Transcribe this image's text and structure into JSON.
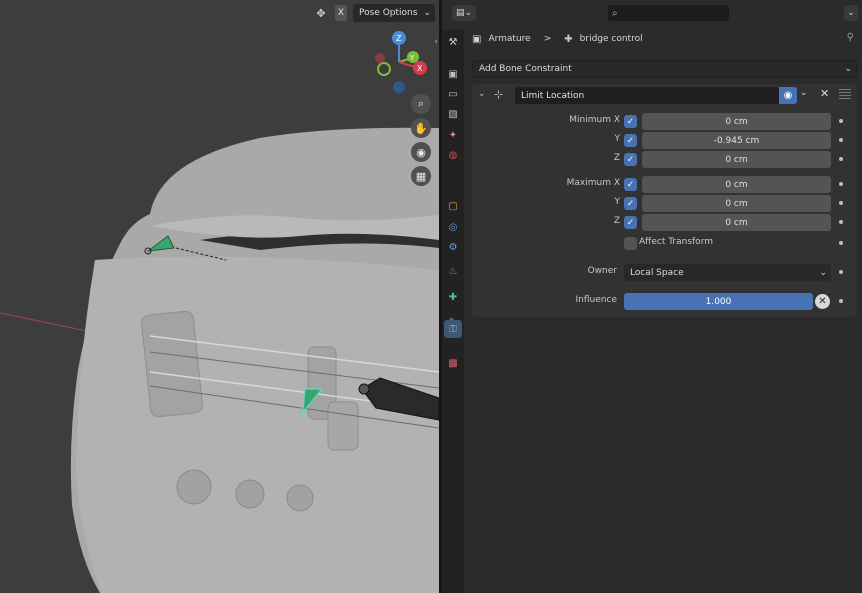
{
  "viewport": {
    "header": {
      "gizmo_toggle_icon": "gizmo-toggle-icon",
      "x_mirror_label": "X",
      "pose_options_label": "Pose Options",
      "dropdown_icon": "chevron-down-icon"
    },
    "gizmo": {
      "z_label": "Z",
      "y_label": "Y",
      "x_label": "X"
    },
    "tools": [
      "zoom-icon",
      "hand-pan-icon",
      "camera-icon",
      "grid-icon"
    ],
    "collapse_icon": "chevron-left-icon"
  },
  "properties": {
    "header": {
      "editor_type_icon": "properties-editor-icon",
      "search_icon": "search-icon",
      "options_icon": "chevron-down-icon"
    },
    "tabs": [
      "tool-icon",
      "render-icon",
      "output-icon",
      "view-layer-icon",
      "scene-icon",
      "world-icon",
      "object-icon",
      "modifier-icon",
      "particles-icon",
      "physics-icon",
      "object-data-icon",
      "bone-icon",
      "bone-constraint-icon",
      "texture-icon"
    ],
    "active_tab": "bone-constraint-icon",
    "breadcrumb": {
      "object": "Armature",
      "separator": ">",
      "bone": "bridge control"
    },
    "add_constraint_label": "Add Bone Constraint",
    "constraint": {
      "name": "Limit Location",
      "rows": {
        "min_x": {
          "label": "Minimum X",
          "checked": true,
          "value": "0 cm"
        },
        "min_y": {
          "label": "Y",
          "checked": true,
          "value": "-0.945 cm"
        },
        "min_z": {
          "label": "Z",
          "checked": true,
          "value": "0 cm"
        },
        "max_x": {
          "label": "Maximum X",
          "checked": true,
          "value": "0 cm"
        },
        "max_y": {
          "label": "Y",
          "checked": true,
          "value": "0 cm"
        },
        "max_z": {
          "label": "Z",
          "checked": true,
          "value": "0 cm"
        }
      },
      "affect_transform": {
        "label": "Affect Transform",
        "checked": false
      },
      "owner": {
        "label": "Owner",
        "value": "Local Space"
      },
      "influence": {
        "label": "Influence",
        "value": "1.000",
        "fraction": 1.0
      }
    }
  },
  "colors": {
    "accent_blue": "#4772b3",
    "viewport_bg": "#3d3d3d",
    "panel_bg": "#2b2b2b",
    "bone_green": "#3aa56e",
    "bone_selected_outline": "#5fd9c2"
  }
}
